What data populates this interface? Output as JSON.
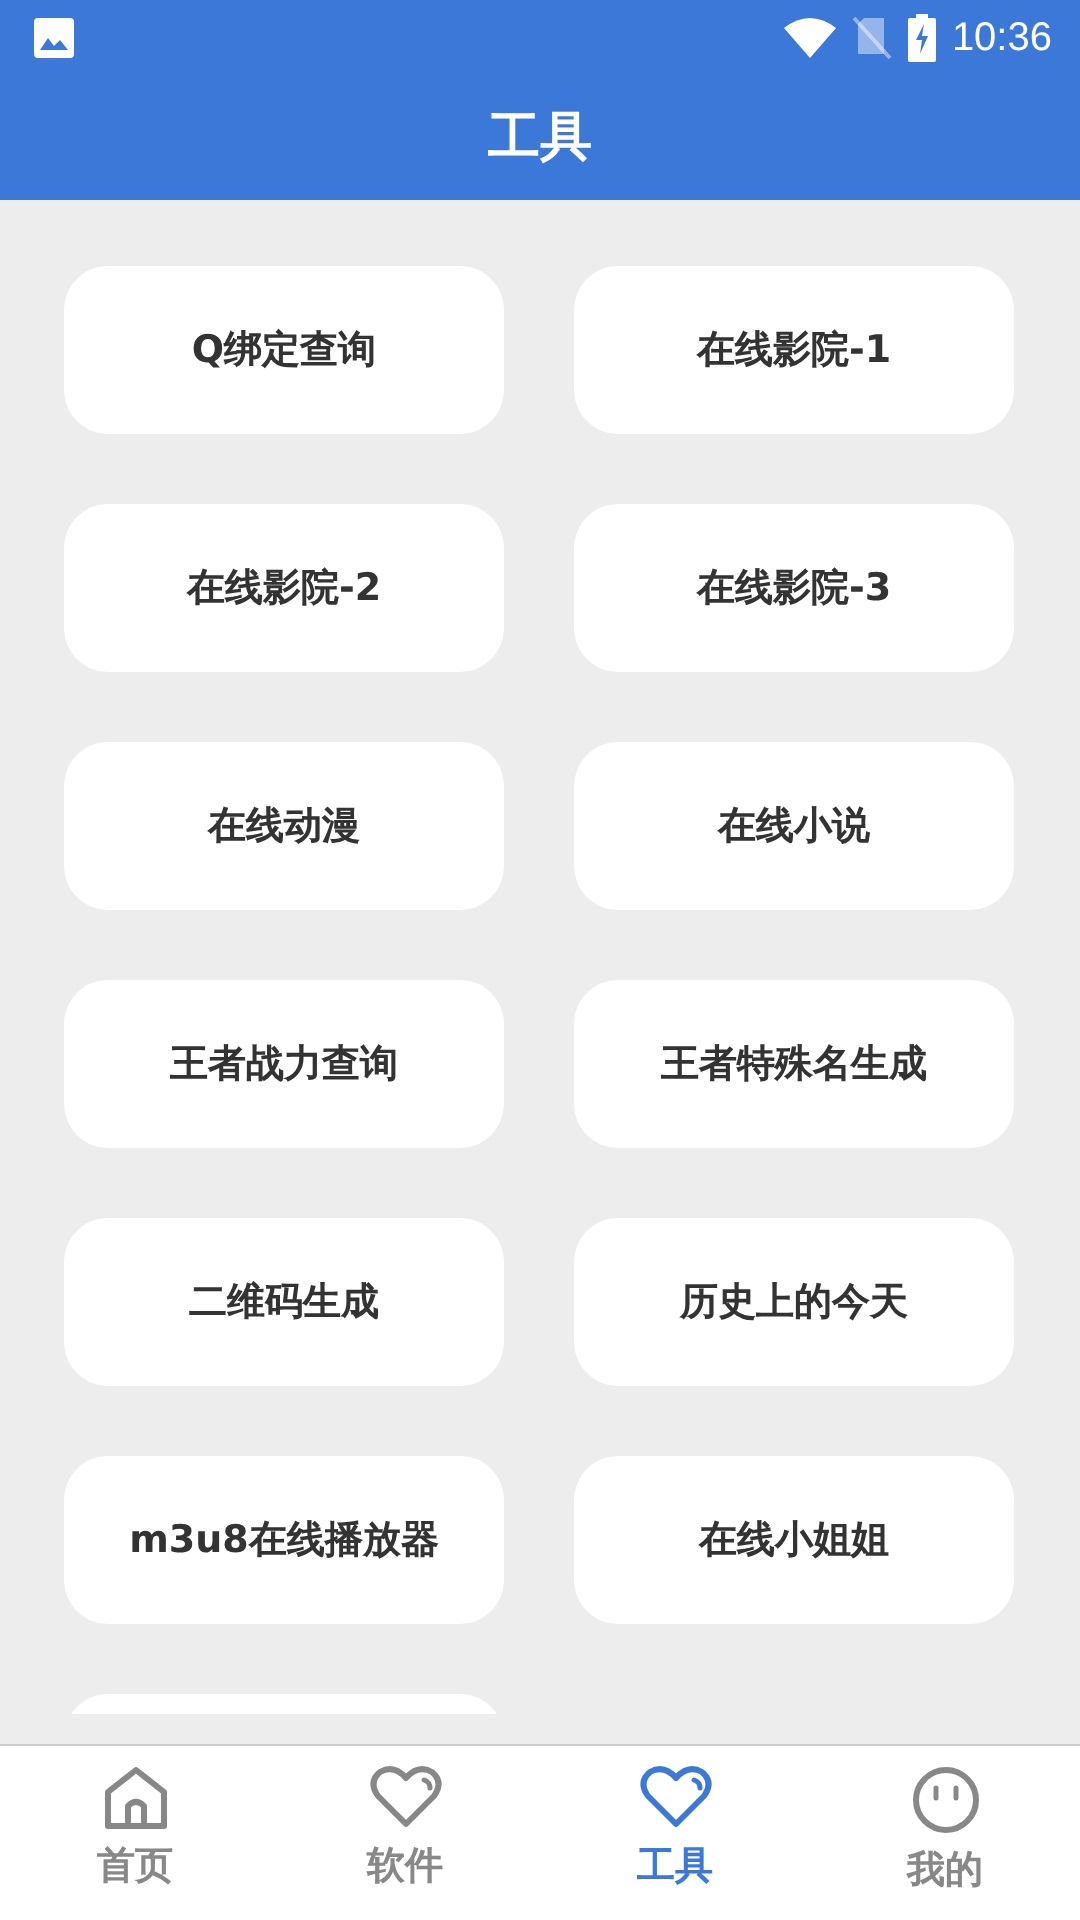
{
  "status_bar": {
    "time": "10:36"
  },
  "header": {
    "title": "工具"
  },
  "tools": [
    {
      "label": "Q绑定查询"
    },
    {
      "label": "在线影院-1"
    },
    {
      "label": "在线影院-2"
    },
    {
      "label": "在线影院-3"
    },
    {
      "label": "在线动漫"
    },
    {
      "label": "在线小说"
    },
    {
      "label": "王者战力查询"
    },
    {
      "label": "王者特殊名生成"
    },
    {
      "label": "二维码生成"
    },
    {
      "label": "历史上的今天"
    },
    {
      "label": "m3u8在线播放器"
    },
    {
      "label": "在线小姐姐"
    }
  ],
  "clipped_card": true,
  "bottom_nav": [
    {
      "label": "首页",
      "kind": "home",
      "selected": false
    },
    {
      "label": "软件",
      "kind": "heart",
      "selected": false
    },
    {
      "label": "工具",
      "kind": "heart",
      "selected": true
    },
    {
      "label": "我的",
      "kind": "face",
      "selected": false
    }
  ]
}
